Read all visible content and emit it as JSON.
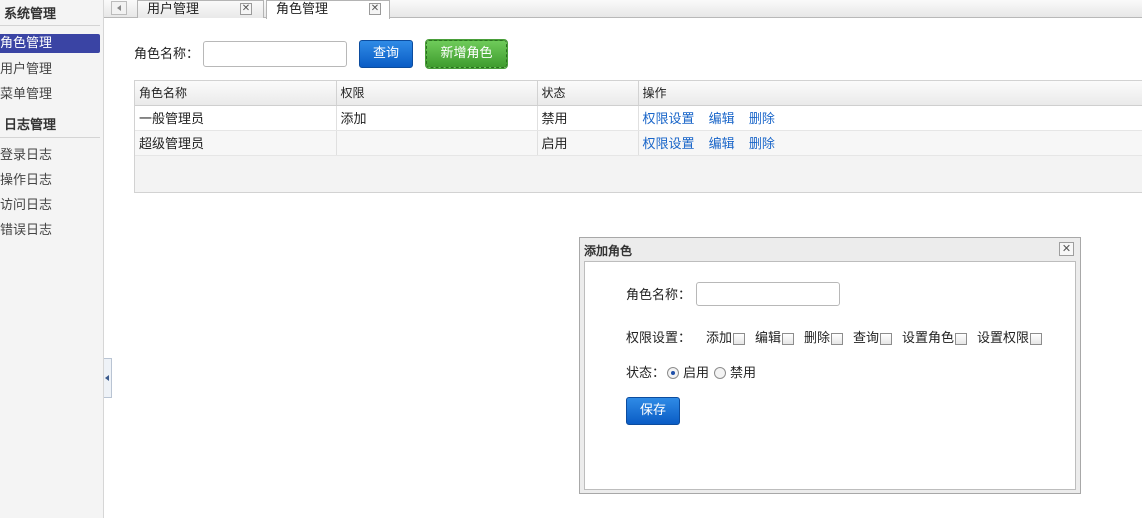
{
  "sidebar": {
    "groups": [
      "系统管理",
      "日志管理"
    ],
    "items": [
      "角色管理",
      "用户管理",
      "菜单管理",
      "登录日志",
      "操作日志",
      "访问日志",
      "错误日志"
    ]
  },
  "tabs": [
    {
      "label": "用户管理"
    },
    {
      "label": "角色管理"
    }
  ],
  "tab_close_glyph": "✕",
  "search": {
    "label": "角色名称：",
    "query_label": "查询",
    "add_label": "新增角色"
  },
  "table": {
    "headers": [
      "角色名称",
      "权限",
      "状态",
      "操作"
    ],
    "rows": [
      {
        "name": "一般管理员",
        "perm": "添加",
        "status": "禁用",
        "ops": [
          "权限设置",
          "编辑",
          "删除"
        ]
      },
      {
        "name": "超级管理员",
        "perm": "",
        "status": "启用",
        "ops": [
          "权限设置",
          "编辑",
          "删除"
        ]
      }
    ]
  },
  "dialog": {
    "title": "添加角色",
    "close_glyph": "✕",
    "name_label": "角色名称：",
    "perm_label": "权限设置：",
    "perms": [
      "添加",
      "编辑",
      "删除",
      "查询",
      "设置角色",
      "设置权限"
    ],
    "status_label": "状态：",
    "status_options": [
      "启用",
      "禁用"
    ],
    "status_selected": "启用",
    "save_label": "保存"
  },
  "colors": {
    "primary_blue": "#0a5cc5",
    "add_green": "#3f9c2e",
    "sidebar_active": "#3a44a4",
    "link": "#1a66c9"
  }
}
